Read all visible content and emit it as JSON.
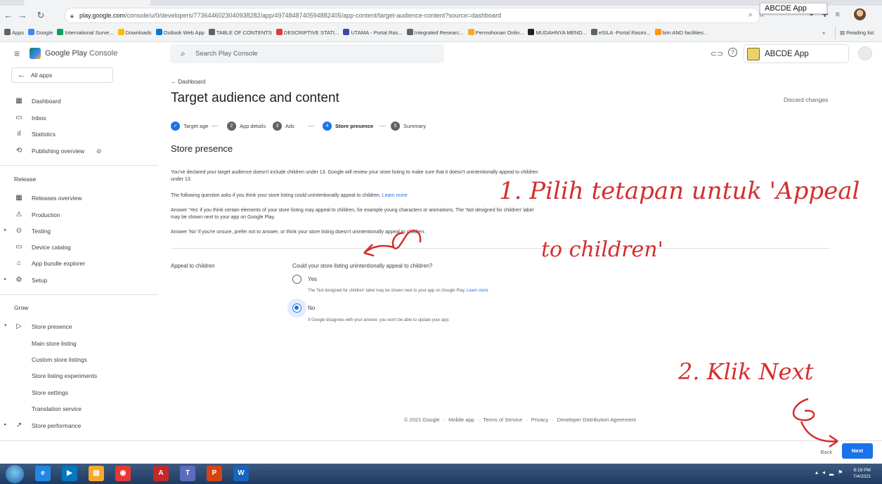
{
  "browser": {
    "url_host": "play.google.com",
    "url_path": "/console/u/0/developers/7736446023040938282/app/4974848740594882405/app-content/target-audience-content?source=dashboard",
    "tooltip": "ABCDE App",
    "bookmarks": [
      "Apps",
      "Google",
      "International Surve...",
      "Downloads",
      "Outlook Web App",
      "TABLE OF CONTENTS",
      "DESCRIPTIVE STATI...",
      "UTAMA - Portal Ras...",
      "Integrated Researc...",
      "Permohonan Onlin...",
      "MUDAHNYA MEND...",
      "eSILA -Portal Rasmi...",
      "bim AND facilities..."
    ],
    "more_bookmarks": "»",
    "reading_list": "Reading list"
  },
  "header": {
    "title_main": "Google Play",
    "title_sub": "Console",
    "search_placeholder": "Search Play Console",
    "app_name": "ABCDE App"
  },
  "sidebar": {
    "all_apps": "All apps",
    "top_items": [
      {
        "label": "Dashboard",
        "icon": "dashboard-icon",
        "glyph": "▦"
      },
      {
        "label": "Inbox",
        "icon": "inbox-icon",
        "glyph": "▭"
      },
      {
        "label": "Statistics",
        "icon": "statistics-icon",
        "glyph": "ıl"
      },
      {
        "label": "Publishing overview",
        "icon": "publishing-overview-icon",
        "glyph": "⟲"
      }
    ],
    "release_header": "Release",
    "release_items": [
      {
        "label": "Releases overview",
        "icon": "releases-overview-icon",
        "glyph": "▦"
      },
      {
        "label": "Production",
        "icon": "production-icon",
        "glyph": "⚠"
      },
      {
        "label": "Testing",
        "icon": "testing-icon",
        "glyph": "⊙"
      },
      {
        "label": "Device catalog",
        "icon": "device-catalog-icon",
        "glyph": "▭"
      },
      {
        "label": "App bundle explorer",
        "icon": "app-bundle-explorer-icon",
        "glyph": "⌂"
      },
      {
        "label": "Setup",
        "icon": "setup-icon",
        "glyph": "⚙"
      }
    ],
    "grow_header": "Grow",
    "grow_items": [
      {
        "label": "Store presence",
        "icon": "store-presence-icon",
        "glyph": "▷"
      },
      {
        "label": "Main store listing"
      },
      {
        "label": "Custom store listings"
      },
      {
        "label": "Store listing experiments"
      },
      {
        "label": "Store settings"
      },
      {
        "label": "Translation service"
      },
      {
        "label": "Store performance",
        "icon": "store-performance-icon",
        "glyph": "↗"
      }
    ]
  },
  "main": {
    "breadcrumb": "Dashboard",
    "title": "Target audience and content",
    "discard": "Discard changes",
    "steps": [
      {
        "num": "",
        "label": "Target age",
        "state": "done"
      },
      {
        "num": "2",
        "label": "App details",
        "state": "todo"
      },
      {
        "num": "3",
        "label": "Ads",
        "state": "todo"
      },
      {
        "num": "4",
        "label": "Store presence",
        "state": "active"
      },
      {
        "num": "5",
        "label": "Summary",
        "state": "todo"
      }
    ],
    "section_title": "Store presence",
    "para1": "You've declared your target audience doesn't include children under 13. Google will review your store listing to make sure that it doesn't unintentionally appeal to children under 13.",
    "para2": "The following question asks if you think your store listing could unintentionally appeal to children.",
    "para2_link": "Learn more",
    "para3": "Answer 'Yes' if you think certain elements of your store listing may appeal to children, for example young characters or animations. The 'Not designed for children' label may be shown next to your app on Google Play.",
    "para4": "Answer 'No' if you're unsure, prefer not to answer, or think your store listing doesn't unintentionally appeal to children.",
    "field_label": "Appeal to children",
    "question": "Could your store listing unintentionally appeal to children?",
    "yes_label": "Yes",
    "yes_help": "The 'Not designed for children' label may be shown next to your app on Google Play.",
    "yes_help_link": "Learn more",
    "no_label": "No",
    "no_help": "If Google disagrees with your answer, you won't be able to update your app.",
    "selected": "No",
    "footer": [
      "© 2021 Google",
      "Mobile app",
      "Terms of Service",
      "Privacy",
      "Developer Distribution Agreement"
    ]
  },
  "actions": {
    "back": "Back",
    "next": "Next"
  },
  "taskbar": {
    "clock_time": "8:18 PM",
    "clock_date": "7/4/2021"
  },
  "annotations": {
    "step1_line1": "1. Pilih tetapan untuk 'Appeal",
    "step1_line2": "to children'",
    "step2": "2. Klik Next"
  },
  "colors": {
    "accent": "#1a73e8",
    "annotation": "#d32f2f"
  }
}
